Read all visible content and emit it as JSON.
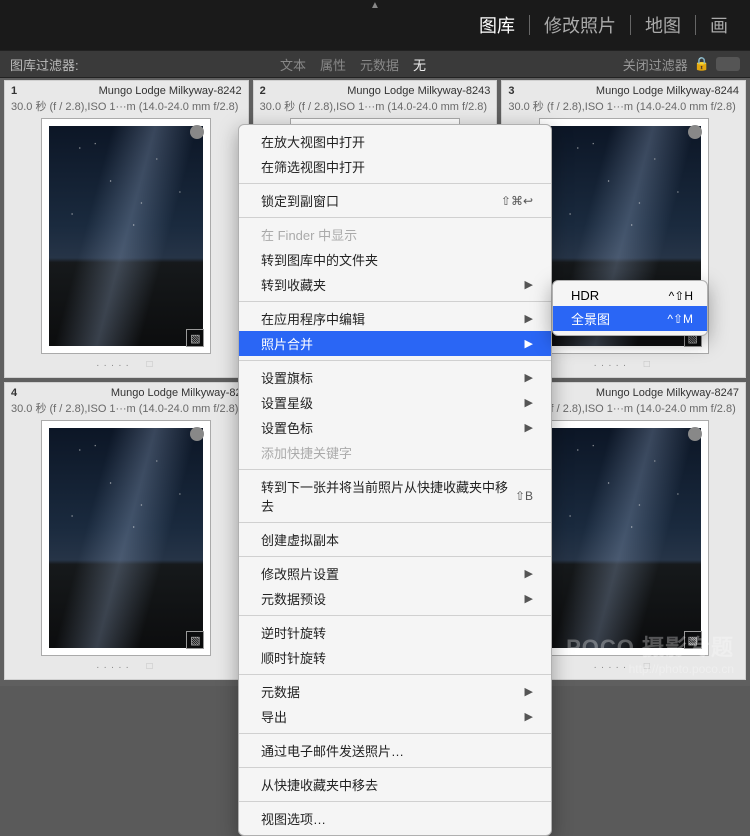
{
  "header": {
    "modules": [
      "图库",
      "修改照片",
      "地图",
      "画"
    ],
    "active": "图库"
  },
  "filter_bar": {
    "label": "图库过滤器:",
    "items": [
      "文本",
      "属性",
      "元数据",
      "无"
    ],
    "active": "无",
    "close_label": "关闭过滤器"
  },
  "grid": {
    "meta_template": "30.0 秒 (f / 2.8),ISO 1···m (14.0-24.0 mm f/2.8)",
    "row1": [
      {
        "num": "1",
        "title": "Mungo Lodge Milkyway-8242"
      },
      {
        "num": "2",
        "title": "Mungo Lodge Milkyway-8243"
      },
      {
        "num": "3",
        "title": "Mungo Lodge Milkyway-8244"
      }
    ],
    "row2": [
      {
        "num": "4",
        "title": "Mungo Lodge Milkyway-82"
      },
      {
        "num": "",
        "title": ""
      },
      {
        "num": "",
        "title": "Mungo Lodge Milkyway-8247"
      }
    ]
  },
  "context_menu": {
    "open_loupe": "在放大视图中打开",
    "open_survey": "在筛选视图中打开",
    "lock_second": "锁定到副窗口",
    "lock_shortcut": "⇧⌘↩",
    "show_finder": "在 Finder 中显示",
    "goto_lib_folder": "转到图库中的文件夹",
    "goto_collection": "转到收藏夹",
    "edit_in_app": "在应用程序中编辑",
    "photo_merge": "照片合并",
    "set_flag": "设置旗标",
    "set_rating": "设置星级",
    "set_color": "设置色标",
    "add_keyword": "添加快捷关键字",
    "goto_next": "转到下一张并将当前照片从快捷收藏夹中移去",
    "goto_next_shortcut": "⇧B",
    "create_virtual": "创建虚拟副本",
    "dev_settings": "修改照片设置",
    "metadata_presets": "元数据预设",
    "rotate_ccw": "逆时针旋转",
    "rotate_cw": "顺时针旋转",
    "metadata": "元数据",
    "export": "导出",
    "email": "通过电子邮件发送照片…",
    "remove_quick": "从快捷收藏夹中移去",
    "view_options": "视图选项…"
  },
  "submenu": {
    "hdr": "HDR",
    "hdr_shortcut": "^⇧H",
    "pano": "全景图",
    "pano_shortcut": "^⇧M"
  },
  "watermark": {
    "main": "POCO 摄影专题",
    "sub": "http://photo.poco.cn"
  }
}
